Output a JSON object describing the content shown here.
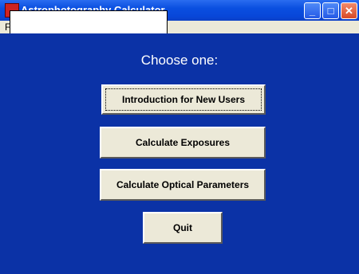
{
  "window": {
    "title": "Astrophotography Calculator",
    "menu_first_letter": "F",
    "controls": {
      "minimize": "_",
      "maximize": "□",
      "close": "✕"
    }
  },
  "main": {
    "heading": "Choose one:",
    "buttons": [
      {
        "label": "Introduction for New Users",
        "focused": true
      },
      {
        "label": "Calculate Exposures"
      },
      {
        "label": "Calculate Optical Parameters"
      },
      {
        "label": "Quit"
      }
    ]
  },
  "colors": {
    "background": "#0b32a6",
    "button_face": "#ece9d8",
    "titlebar": "#0a4fe0"
  },
  "icons": [
    "app-icon",
    "minimize-icon",
    "maximize-icon",
    "close-icon"
  ]
}
